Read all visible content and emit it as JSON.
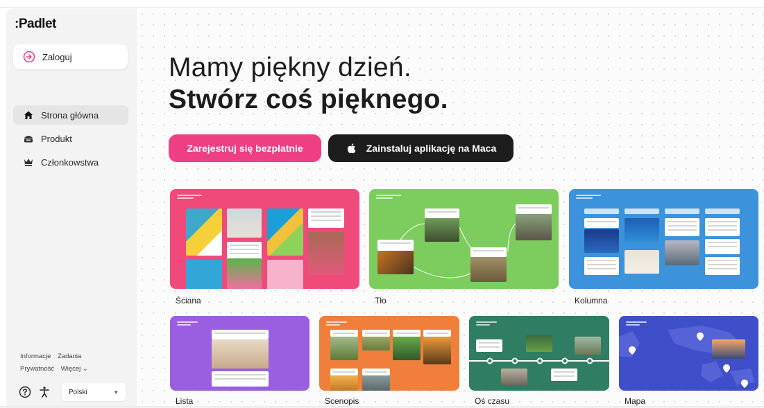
{
  "app": {
    "logo": ":Padlet"
  },
  "sidebar": {
    "login_label": "Zaloguj",
    "nav": [
      {
        "label": "Strona główna",
        "icon": "home-icon",
        "active": true
      },
      {
        "label": "Produkt",
        "icon": "product-icon",
        "active": false
      },
      {
        "label": "Członkowstwa",
        "icon": "crown-icon",
        "active": false
      }
    ],
    "footer_links_row1": [
      "Informacje",
      "Zadania"
    ],
    "footer_links_row2": [
      "Prywatność",
      "Więcej ⌄"
    ],
    "language": "Polski"
  },
  "hero": {
    "line1": "Mamy piękny dzień.",
    "line2": "Stwórz coś pięknego.",
    "signup_label": "Zarejestruj się bezpłatnie",
    "mac_label": "Zainstaluj aplikację na Maca"
  },
  "templates": [
    {
      "label": "Ściana",
      "color": "#ef4a7a"
    },
    {
      "label": "Tło",
      "color": "#7ccd5e"
    },
    {
      "label": "Kolumna",
      "color": "#3d92dc"
    },
    {
      "label": "Lista",
      "color": "#9a5fe0"
    },
    {
      "label": "Scenopis",
      "color": "#f07f3c"
    },
    {
      "label": "Oś czasu",
      "color": "#2f7d62"
    },
    {
      "label": "Mapa",
      "color": "#3f4fc9"
    }
  ],
  "colors": {
    "accent_pink": "#ee3f84",
    "dark_button": "#1d1d1d"
  }
}
